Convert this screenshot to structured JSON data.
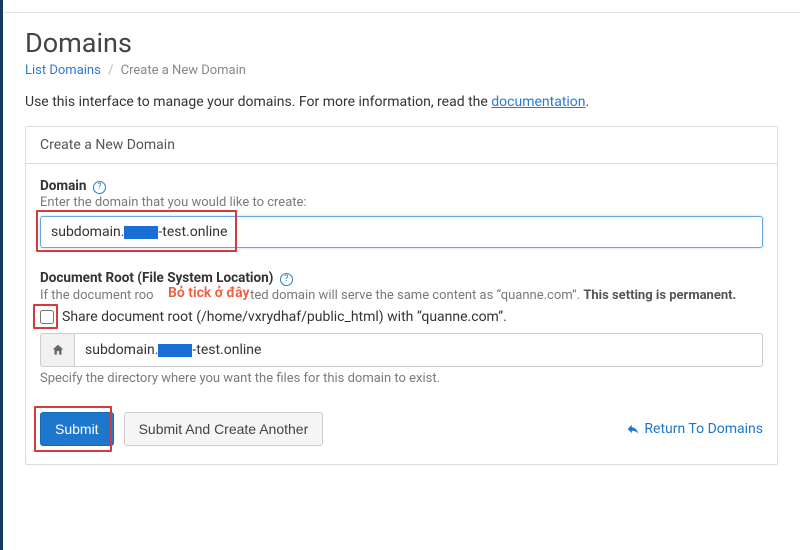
{
  "page": {
    "title": "Domains",
    "intro_prefix": "Use this interface to manage your domains. For more information, read the ",
    "intro_link": "documentation",
    "intro_suffix": "."
  },
  "breadcrumb": {
    "list_link": "List Domains",
    "separator": "/",
    "current": "Create a New Domain"
  },
  "panel": {
    "header": "Create a New Domain"
  },
  "domain_field": {
    "label": "Domain",
    "hint": "Enter the domain that you would like to create:",
    "value_pre": "subdomain.",
    "value_post": "-test.online"
  },
  "docroot": {
    "label": "Document Root (File System Location)",
    "hint_pre": "If the document roo",
    "hint_mid": "ted domain will serve the same content as “quanne.com”. ",
    "hint_strong": "This setting is permanent.",
    "checkbox_label": "Share document root (/home/vxrydhaf/public_html) with “quanne.com”.",
    "checked": false,
    "path_value_pre": "subdomain.",
    "path_value_post": "-test.online",
    "dir_hint": "Specify the directory where you want the files for this domain to exist."
  },
  "buttons": {
    "submit": "Submit",
    "submit_another": "Submit And Create Another",
    "return": "Return To Domains"
  },
  "annotation": {
    "text": "Bỏ tick ở đây"
  },
  "icons": {
    "help": "?",
    "home": "home-icon",
    "reply": "reply-icon"
  }
}
